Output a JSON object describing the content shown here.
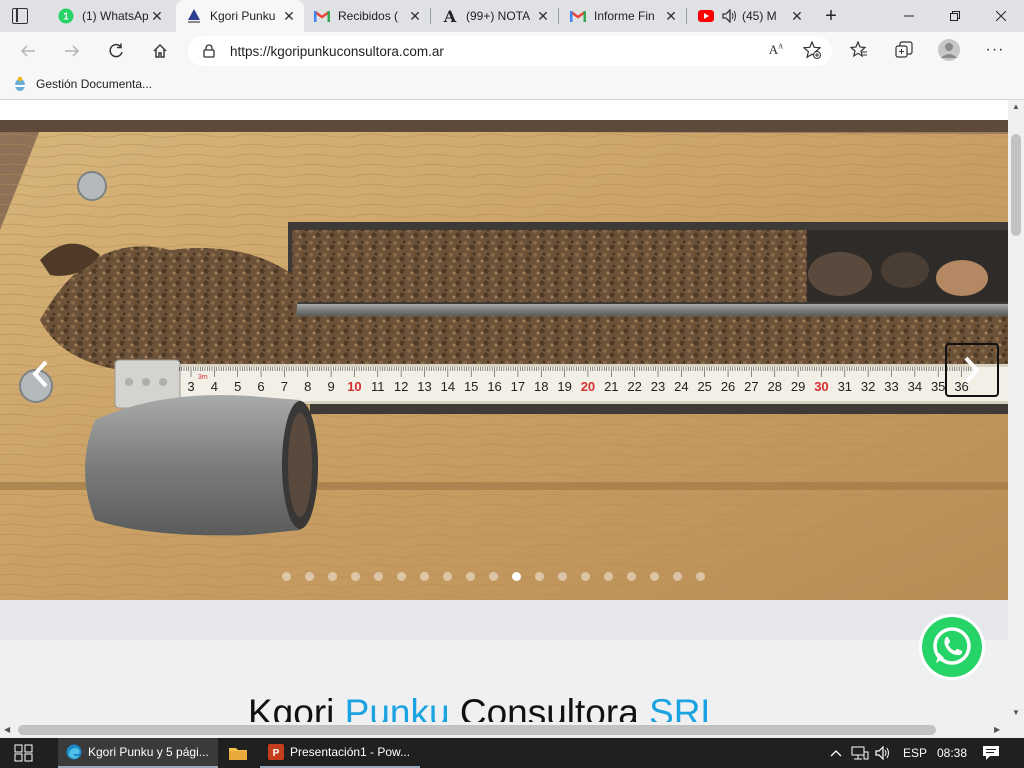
{
  "browser": {
    "tabs": [
      {
        "label": "(1) WhatsApp",
        "icon": "whatsapp-icon",
        "active": false
      },
      {
        "label": "Kgori Punku",
        "icon": "kgori-logo-icon",
        "active": true
      },
      {
        "label": "Recibidos (",
        "icon": "gmail-icon",
        "active": false
      },
      {
        "label": "(99+) NOTA",
        "icon": "a-letter-icon",
        "active": false
      },
      {
        "label": "Informe Fin",
        "icon": "gmail-icon",
        "active": false
      },
      {
        "label": "(45) M",
        "icon": "youtube-icon",
        "active": false
      }
    ],
    "whatsapp_badge": "1",
    "new_tab_glyph": "+",
    "url": "https://kgoripunkuconsultora.com.ar",
    "favorites": [
      {
        "label": "Gestión Documenta...",
        "icon": "argentina-seal-icon"
      }
    ]
  },
  "page": {
    "carousel": {
      "dot_count": 19,
      "active_dot": 10,
      "prev_icon": "chevron-left-icon",
      "next_icon": "chevron-right-icon",
      "image_subject": "core-sample-tray",
      "tape_numbers": [
        "3",
        "4",
        "5",
        "6",
        "7",
        "8",
        "9",
        "10",
        "11",
        "12",
        "13",
        "14",
        "15",
        "16",
        "17",
        "18",
        "19",
        "20",
        "21",
        "22",
        "23",
        "24",
        "25",
        "26",
        "27",
        "28",
        "29",
        "30",
        "31",
        "32",
        "33",
        "34",
        "35",
        "36"
      ],
      "tape_small_mark": "3m"
    },
    "headline": {
      "part1": "Kgori ",
      "part2": "Punku",
      "part3": " Consultora ",
      "part4": "SRL"
    },
    "colors": {
      "accent": "#1aa3e0",
      "whatsapp": "#25d366"
    }
  },
  "taskbar": {
    "items": [
      {
        "label": "Kgori Punku y 5 pági...",
        "icon": "edge-icon"
      },
      {
        "label": "",
        "icon": "file-explorer-icon"
      },
      {
        "label": "Presentación1 - Pow...",
        "icon": "powerpoint-icon"
      }
    ],
    "language": "ESP",
    "time": "08:38"
  }
}
